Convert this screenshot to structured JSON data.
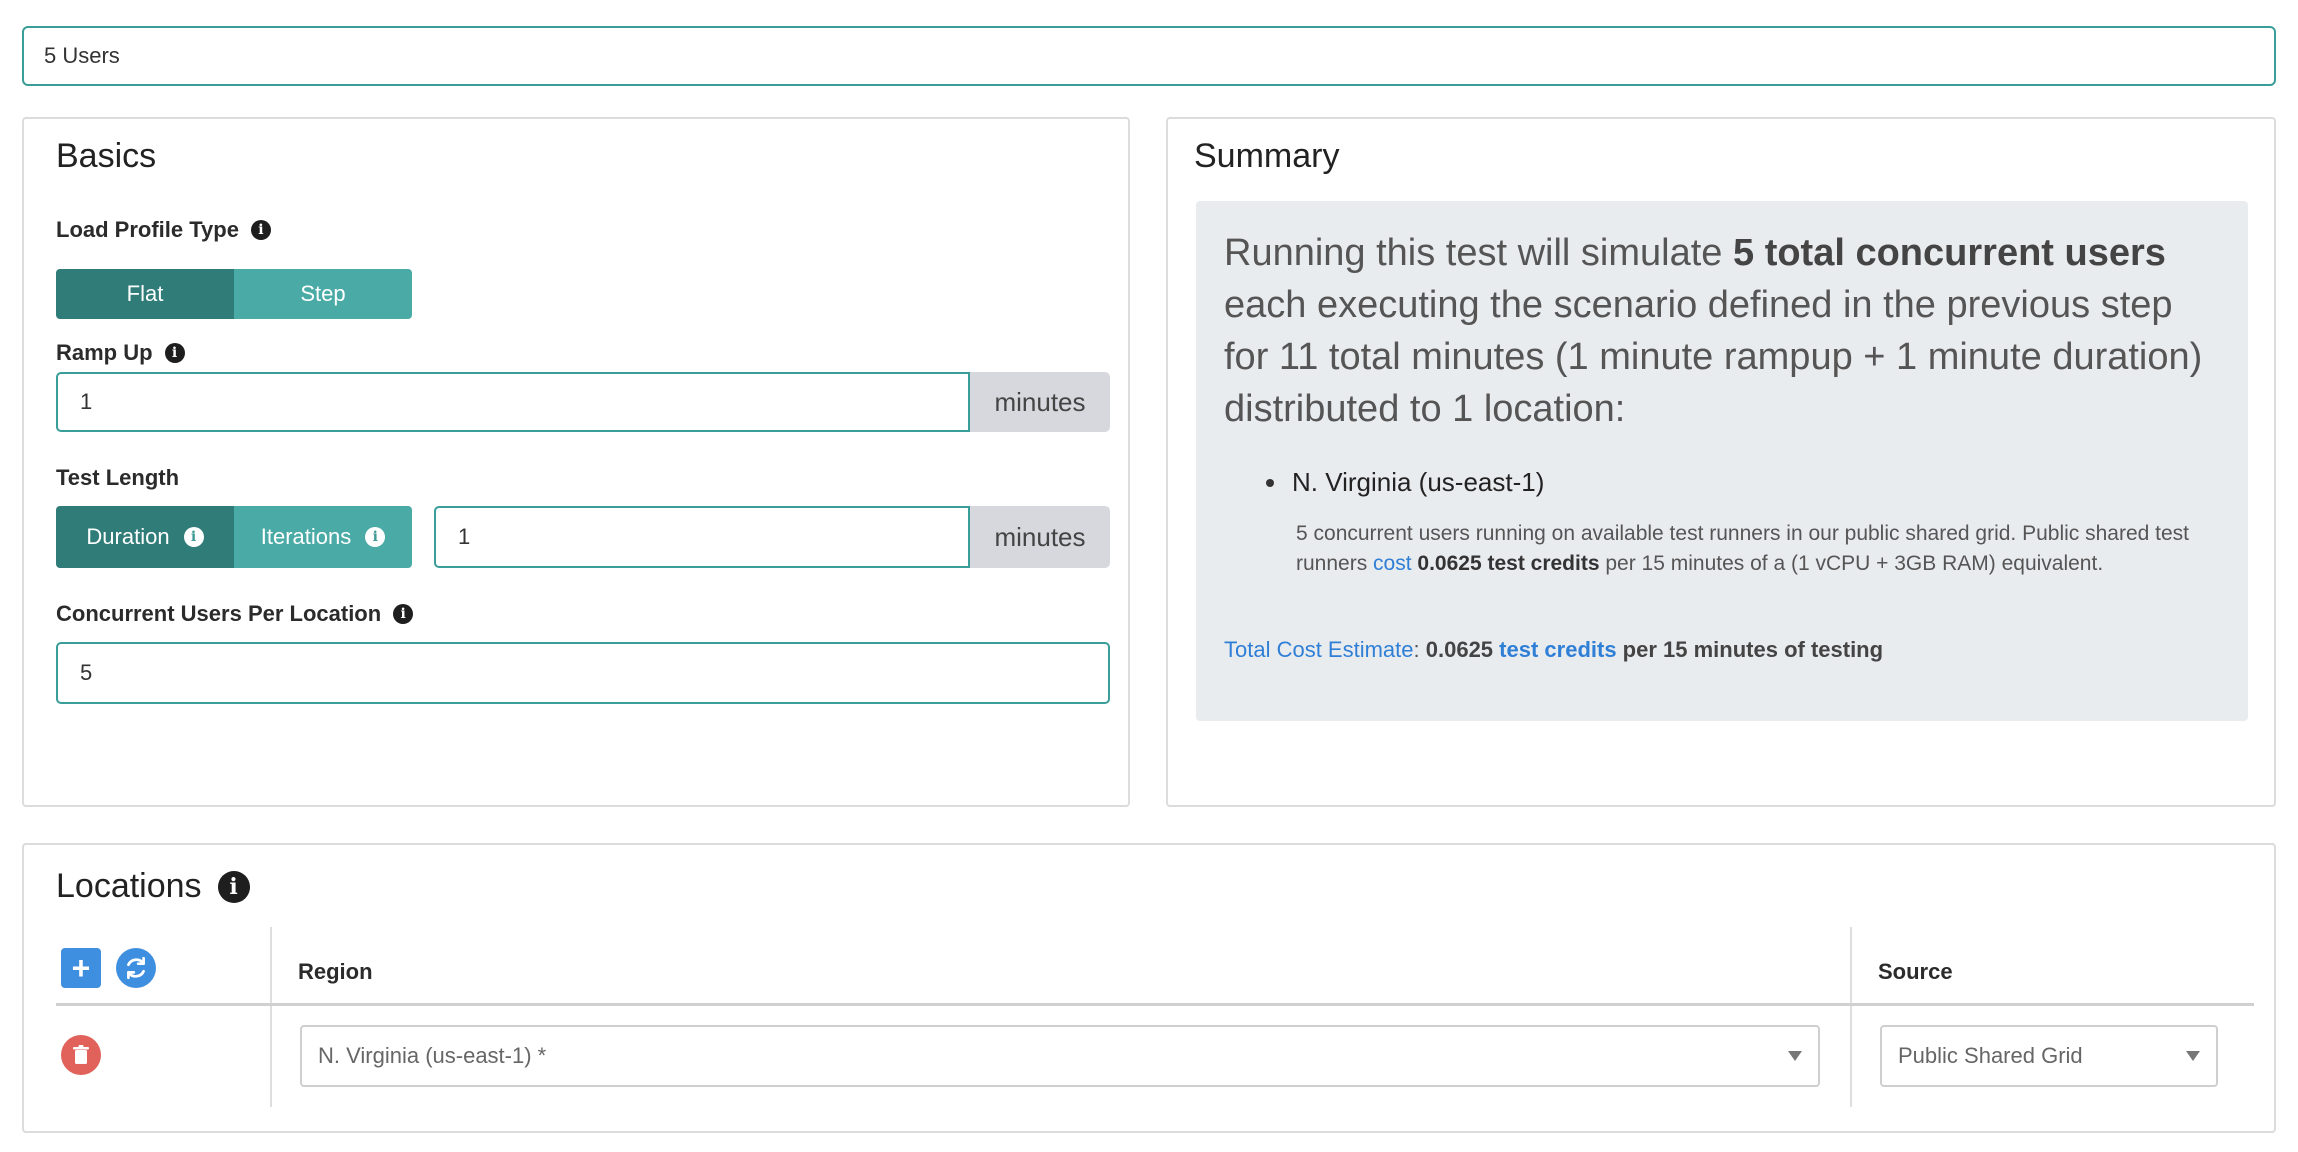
{
  "test_name": "5 Users",
  "basics": {
    "title": "Basics",
    "load_profile_type": {
      "label": "Load Profile Type",
      "options": [
        "Flat",
        "Step"
      ],
      "selected": "Flat"
    },
    "ramp_up": {
      "label": "Ramp Up",
      "value": "1",
      "unit": "minutes"
    },
    "test_length": {
      "label": "Test Length",
      "options": [
        "Duration",
        "Iterations"
      ],
      "selected": "Duration",
      "value": "1",
      "unit": "minutes"
    },
    "concurrent_users": {
      "label": "Concurrent Users Per Location",
      "value": "5"
    }
  },
  "summary": {
    "title": "Summary",
    "lead_prefix": "Running this test will simulate ",
    "lead_bold": "5 total concurrent users",
    "lead_suffix": " each executing the scenario defined in the previous step for 11 total minutes (1 minute rampup + 1 minute duration) distributed to 1 location:",
    "location_name": "N. Virginia (us-east-1)",
    "location_desc_1": "5 concurrent users running on available test runners in our public shared grid. Public shared test runners ",
    "location_desc_link": "cost",
    "location_desc_bold": "0.0625 test credits",
    "location_desc_2": " per 15 minutes of a (1 vCPU + 3GB RAM) equivalent.",
    "total_label": "Total Cost Estimate",
    "total_sep": ": ",
    "total_value": "0.0625",
    "total_unit": "test credits",
    "total_suffix": " per 15 minutes of testing"
  },
  "locations": {
    "title": "Locations",
    "columns": {
      "region": "Region",
      "source": "Source"
    },
    "rows": [
      {
        "region": "N. Virginia (us-east-1) *",
        "source": "Public Shared Grid"
      }
    ]
  },
  "colors": {
    "teal_active": "#2f7c78",
    "teal_inactive": "#4aaaa6",
    "link_blue": "#2f7fd6",
    "delete_red": "#e0625a"
  }
}
